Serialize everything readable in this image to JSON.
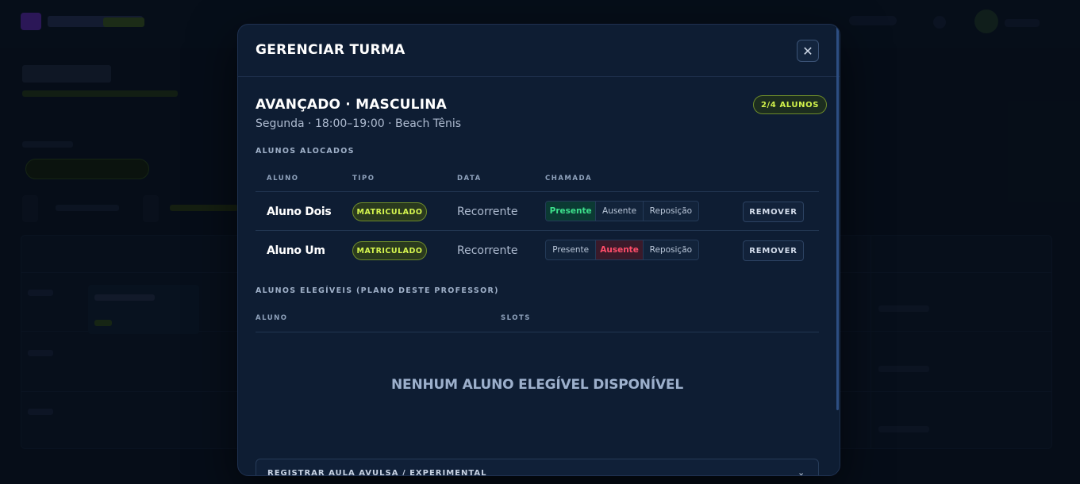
{
  "modal": {
    "title": "GERENCIAR TURMA",
    "close_symbol": "✕"
  },
  "turma": {
    "name": "AVANÇADO · MASCULINA",
    "meta": "Segunda · 18:00–19:00 · Beach Tênis",
    "count_badge": "2/4 ALUNOS"
  },
  "alocados": {
    "section_label": "ALUNOS ALOCADOS",
    "columns": [
      "ALUNO",
      "TIPO",
      "DATA",
      "CHAMADA"
    ],
    "rows": [
      {
        "name": "Aluno Dois",
        "tipo": "MATRICULADO",
        "data": "Recorrente",
        "attendance": [
          "Presente",
          "Ausente",
          "Reposição"
        ],
        "selected": "Presente",
        "remove": "REMOVER"
      },
      {
        "name": "Aluno Um",
        "tipo": "MATRICULADO",
        "data": "Recorrente",
        "attendance": [
          "Presente",
          "Ausente",
          "Reposição"
        ],
        "selected": "Ausente",
        "remove": "REMOVER"
      }
    ]
  },
  "elegiveis": {
    "section_label": "ALUNOS ELEGÍVEIS (PLANO DESTE PROFESSOR)",
    "columns": [
      "ALUNO",
      "SLOTS"
    ],
    "empty_message": "NENHUM ALUNO ELEGÍVEL DISPONÍVEL"
  },
  "accordion": {
    "label": "REGISTRAR AULA AVULSA / EXPERIMENTAL",
    "chevron": "⌄"
  },
  "colors": {
    "accent_lime": "#d6f64f",
    "present_green": "#3de08c",
    "absent_red": "#ff4d6a",
    "modal_bg": "#0e1d33"
  }
}
